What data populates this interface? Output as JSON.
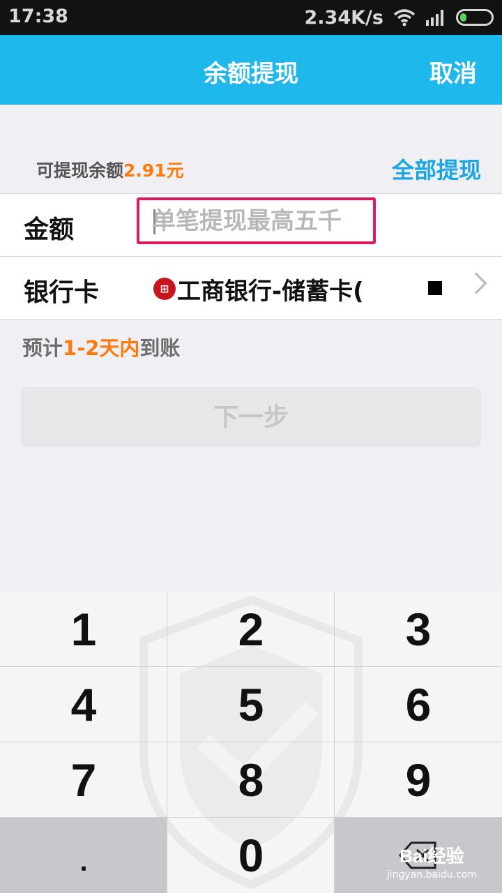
{
  "status_bar": {
    "time": "17:38",
    "speed": "2.34K/s"
  },
  "nav": {
    "title": "余额提现",
    "cancel_label": "取消"
  },
  "balance": {
    "label": "可提现余额",
    "amount": "2.91元",
    "withdraw_all_label": "全部提现"
  },
  "amount_row": {
    "label": "金额",
    "placeholder": "单笔提现最高五千"
  },
  "card_row": {
    "label": "银行卡",
    "bank_icon_text": "⊞",
    "bank_name": "工商银行-储蓄卡("
  },
  "eta": {
    "prefix": "预计",
    "highlight": "1-2天内",
    "suffix": "到账"
  },
  "next_button_label": "下一步",
  "keypad": {
    "keys": [
      "1",
      "2",
      "3",
      "4",
      "5",
      "6",
      "7",
      "8",
      "9",
      ".",
      "0"
    ]
  },
  "watermark": {
    "logo": "Bai经验",
    "url": "jingyan.baidu.com"
  },
  "colors": {
    "nav_blue": "#1fb8ec",
    "accent_orange": "#ff7a0a",
    "link_blue": "#1aa6e2",
    "highlight_pink": "#e0185e",
    "bank_red": "#c7161e"
  }
}
